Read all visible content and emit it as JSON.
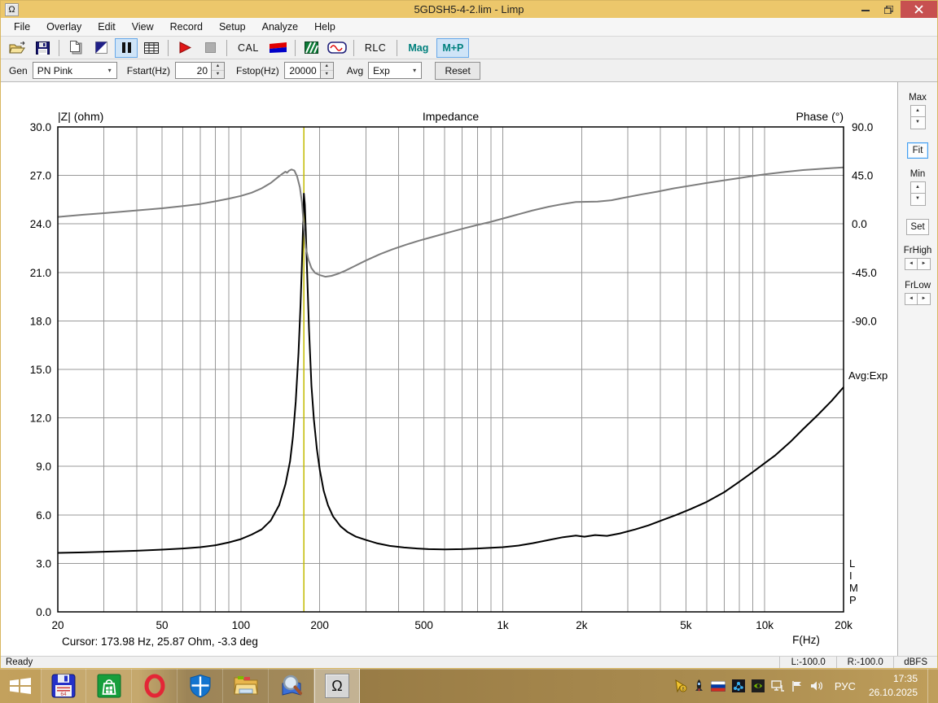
{
  "window": {
    "title": "5GDSH5-4-2.lim - Limp",
    "app_icon_glyph": "Ω"
  },
  "menu": {
    "items": [
      "File",
      "Overlay",
      "Edit",
      "View",
      "Record",
      "Setup",
      "Analyze",
      "Help"
    ]
  },
  "toolbar": {
    "cal_label": "CAL",
    "rlc_label": "RLC",
    "mag_label": "Mag",
    "mp_label": "M+P"
  },
  "genbar": {
    "gen_label": "Gen",
    "gen_value": "PN Pink",
    "fstart_label": "Fstart(Hz)",
    "fstart_value": "20",
    "fstop_label": "Fstop(Hz)",
    "fstop_value": "20000",
    "avg_label": "Avg",
    "avg_value": "Exp",
    "reset_label": "Reset"
  },
  "side_panel": {
    "max_label": "Max",
    "fit_label": "Fit",
    "min_label": "Min",
    "set_label": "Set",
    "frhigh_label": "FrHigh",
    "frlow_label": "FrLow"
  },
  "icons": {
    "combo_arrow": "▾",
    "spin_up": "▲",
    "spin_down": "▼",
    "arrow_left": "◄",
    "arrow_right": "►"
  },
  "chart_data": {
    "type": "line",
    "title": "Impedance",
    "x_axis": {
      "label": "F(Hz)",
      "scale": "log",
      "min": 20,
      "max": 20000,
      "tick_values": [
        20,
        50,
        100,
        200,
        500,
        1000,
        2000,
        5000,
        10000,
        20000
      ],
      "ticks": [
        "20",
        "50",
        "100",
        "200",
        "500",
        "1k",
        "2k",
        "5k",
        "10k",
        "20k"
      ]
    },
    "y_left": {
      "label": "|Z| (ohm)",
      "min": 0,
      "max": 30,
      "step": 3
    },
    "y_right": {
      "label": "Phase (°)",
      "ticks": [
        90,
        45,
        0,
        -45,
        -90
      ],
      "deg_per_div": 45
    },
    "grid": true,
    "cursor": {
      "freq": 173.98,
      "ohm": 25.87,
      "deg": -3.3,
      "text": "Cursor: 173.98 Hz, 25.87 Ohm, -3.3 deg",
      "color": "#c3bb00"
    },
    "annotations": {
      "avg": "Avg:Exp",
      "limp": "LIMP"
    },
    "series": [
      {
        "name": "impedance",
        "axis": "left",
        "color": "#000000",
        "points": [
          [
            20,
            3.65
          ],
          [
            25,
            3.68
          ],
          [
            30,
            3.72
          ],
          [
            40,
            3.78
          ],
          [
            50,
            3.85
          ],
          [
            60,
            3.92
          ],
          [
            70,
            4.0
          ],
          [
            80,
            4.12
          ],
          [
            90,
            4.3
          ],
          [
            100,
            4.5
          ],
          [
            110,
            4.78
          ],
          [
            120,
            5.1
          ],
          [
            130,
            5.65
          ],
          [
            140,
            6.6
          ],
          [
            148,
            7.9
          ],
          [
            154,
            9.3
          ],
          [
            158,
            10.8
          ],
          [
            162,
            13.0
          ],
          [
            166,
            16.0
          ],
          [
            169,
            19.0
          ],
          [
            171,
            21.5
          ],
          [
            173,
            24.2
          ],
          [
            174,
            25.87
          ],
          [
            175.5,
            25.2
          ],
          [
            177,
            23.5
          ],
          [
            179,
            21.0
          ],
          [
            182,
            17.5
          ],
          [
            186,
            14.0
          ],
          [
            190,
            11.9
          ],
          [
            195,
            10.1
          ],
          [
            200,
            8.8
          ],
          [
            207,
            7.5
          ],
          [
            215,
            6.6
          ],
          [
            225,
            5.9
          ],
          [
            240,
            5.3
          ],
          [
            255,
            4.95
          ],
          [
            275,
            4.65
          ],
          [
            300,
            4.45
          ],
          [
            330,
            4.25
          ],
          [
            370,
            4.08
          ],
          [
            420,
            3.98
          ],
          [
            470,
            3.92
          ],
          [
            520,
            3.88
          ],
          [
            600,
            3.86
          ],
          [
            700,
            3.88
          ],
          [
            800,
            3.92
          ],
          [
            900,
            3.96
          ],
          [
            1000,
            4.0
          ],
          [
            1150,
            4.1
          ],
          [
            1300,
            4.25
          ],
          [
            1500,
            4.45
          ],
          [
            1700,
            4.62
          ],
          [
            1900,
            4.72
          ],
          [
            2050,
            4.65
          ],
          [
            2250,
            4.75
          ],
          [
            2500,
            4.7
          ],
          [
            2800,
            4.85
          ],
          [
            3200,
            5.1
          ],
          [
            3600,
            5.35
          ],
          [
            4100,
            5.7
          ],
          [
            4600,
            6.0
          ],
          [
            5200,
            6.35
          ],
          [
            6000,
            6.8
          ],
          [
            7000,
            7.4
          ],
          [
            8000,
            8.05
          ],
          [
            9000,
            8.65
          ],
          [
            10000,
            9.2
          ],
          [
            11000,
            9.7
          ],
          [
            12500,
            10.5
          ],
          [
            14000,
            11.3
          ],
          [
            16000,
            12.2
          ],
          [
            18000,
            13.05
          ],
          [
            20000,
            13.9
          ]
        ]
      },
      {
        "name": "phase",
        "axis": "right",
        "color": "#7d7d7d",
        "points": [
          [
            20,
            6.5
          ],
          [
            25,
            8.5
          ],
          [
            30,
            10
          ],
          [
            40,
            12.5
          ],
          [
            50,
            14.5
          ],
          [
            60,
            16.5
          ],
          [
            70,
            18.5
          ],
          [
            80,
            21
          ],
          [
            90,
            23.5
          ],
          [
            100,
            26
          ],
          [
            110,
            29
          ],
          [
            120,
            33
          ],
          [
            130,
            38
          ],
          [
            138,
            43
          ],
          [
            144,
            46.5
          ],
          [
            148,
            48.5
          ],
          [
            150,
            47.5
          ],
          [
            153,
            49.5
          ],
          [
            156,
            50.5
          ],
          [
            160,
            49.5
          ],
          [
            164,
            44
          ],
          [
            168,
            34
          ],
          [
            171,
            20
          ],
          [
            174,
            -3.3
          ],
          [
            177,
            -22
          ],
          [
            181,
            -33
          ],
          [
            186,
            -41
          ],
          [
            192,
            -45.5
          ],
          [
            200,
            -47.5
          ],
          [
            210,
            -49
          ],
          [
            222,
            -48.2
          ],
          [
            235,
            -46.2
          ],
          [
            250,
            -43.5
          ],
          [
            270,
            -39.5
          ],
          [
            300,
            -34
          ],
          [
            340,
            -28
          ],
          [
            380,
            -23.5
          ],
          [
            430,
            -19
          ],
          [
            480,
            -15.5
          ],
          [
            540,
            -12
          ],
          [
            620,
            -8
          ],
          [
            700,
            -4.5
          ],
          [
            800,
            -1
          ],
          [
            900,
            2
          ],
          [
            1000,
            5
          ],
          [
            1150,
            9
          ],
          [
            1300,
            12.5
          ],
          [
            1500,
            16
          ],
          [
            1700,
            18.5
          ],
          [
            1900,
            20.3
          ],
          [
            2100,
            20.5
          ],
          [
            2300,
            20.7
          ],
          [
            2600,
            22
          ],
          [
            3000,
            25
          ],
          [
            3400,
            27.5
          ],
          [
            3900,
            30
          ],
          [
            4500,
            33
          ],
          [
            5200,
            35.5
          ],
          [
            6000,
            38
          ],
          [
            7000,
            40.5
          ],
          [
            8000,
            42.5
          ],
          [
            9000,
            44.5
          ],
          [
            10000,
            46
          ],
          [
            12000,
            48.3
          ],
          [
            14000,
            50
          ],
          [
            16000,
            51
          ],
          [
            18000,
            51.8
          ],
          [
            20000,
            52.5
          ]
        ]
      }
    ]
  },
  "statusbar": {
    "ready": "Ready",
    "left_level": "L:-100.0",
    "right_level": "R:-100.0",
    "units": "dBFS"
  },
  "taskbar": {
    "floppy_badge": "64",
    "omega_glyph": "Ω",
    "tray": {
      "lang": "РУС",
      "time": "17:35",
      "date": "26.10.2025"
    }
  }
}
